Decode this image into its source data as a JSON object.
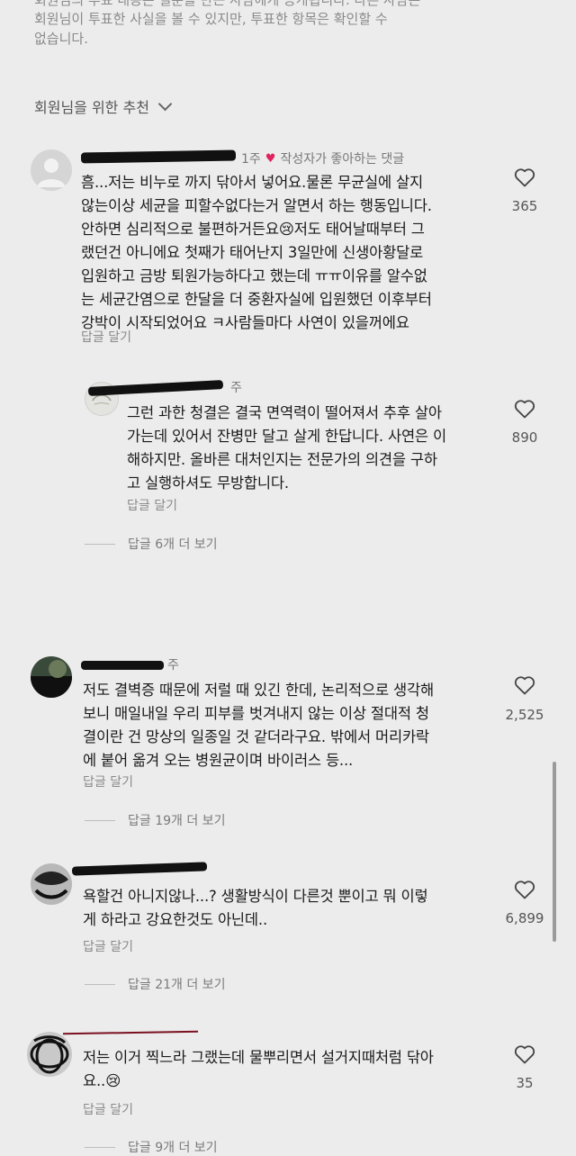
{
  "notice": {
    "line1": "회원님의 투표 내용은 질문을 만든 사람에게 공개됩니다. 다른 사람은",
    "line2": "회원님이 투표한 사실을 볼 수 있지만, 투표한 항목은 확인할 수",
    "line3": "없습니다."
  },
  "recommend": {
    "label": "회원님을 위한 추천"
  },
  "comments": [
    {
      "time": "1주",
      "badge": "작성자가 좋아하는 댓글",
      "lines": [
        "흠...저는 비누로 까지 닦아서 넣어요.물론 무균실에 살지",
        "않는이상 세균을 피할수없다는거 알면서 하는 행동입니다.",
        "안하면 심리적으로 불편하거든요😢저도 태어날때부터 그",
        "랬던건 아니에요 첫째가 태어난지 3일만에 신생아황달로",
        "입원하고 금방 퇴원가능하다고 했는데 ㅠㅠ이유를 알수없",
        "는 세균간염으로 한달을 더 중환자실에 입원했던 이후부터",
        "강박이 시작되었어요 ㅋ사람들마다 사연이 있을꺼에요"
      ],
      "likes": "365",
      "reply_label": "답글 달기"
    },
    {
      "time": "주",
      "lines": [
        "그런 과한 청결은 결국 면역력이 떨어져서 추후 살아",
        "가는데 있어서 잔병만 달고 살게 한답니다. 사연은 이",
        "해하지만. 올바른 대처인지는 전문가의 의견을 구하",
        "고 실행하셔도 무방합니다."
      ],
      "likes": "890",
      "reply_label": "답글 달기",
      "more": "답글 6개 더 보기"
    },
    {
      "time": "주",
      "lines": [
        "저도 결벽증 때문에 저럴 때 있긴 한데, 논리적으로 생각해",
        "보니 매일내일 우리 피부를 벗겨내지 않는 이상 절대적 청",
        "결이란 건 망상의 일종일 것 같더라구요. 밖에서 머리카락",
        "에 붙어 옮겨 오는 병원균이며 바이러스 등..."
      ],
      "likes": "2,525",
      "reply_label": "답글 달기",
      "more": "답글 19개 더 보기"
    },
    {
      "lines": [
        "욕할건 아니지않나...? 생활방식이 다른것 뿐이고 뭐 이렇",
        "게 하라고 강요한것도 아닌데.."
      ],
      "likes": "6,899",
      "reply_label": "답글 달기",
      "more": "답글 21개 더 보기"
    },
    {
      "lines": [
        "저는 이거 찍느라 그랬는데 물뿌리면서 설거지때처럼 닦아",
        "요..😢"
      ],
      "likes": "35",
      "reply_label": "답글 달기",
      "more": "답글 9개 더 보기"
    }
  ],
  "icons": {
    "like": "heart-outline-icon",
    "liked_badge": "heart-filled-icon",
    "expand": "chevron-down-icon"
  },
  "colors": {
    "background": "#ececec",
    "liked_red": "#e0245e",
    "muted": "#8a8a8a"
  }
}
